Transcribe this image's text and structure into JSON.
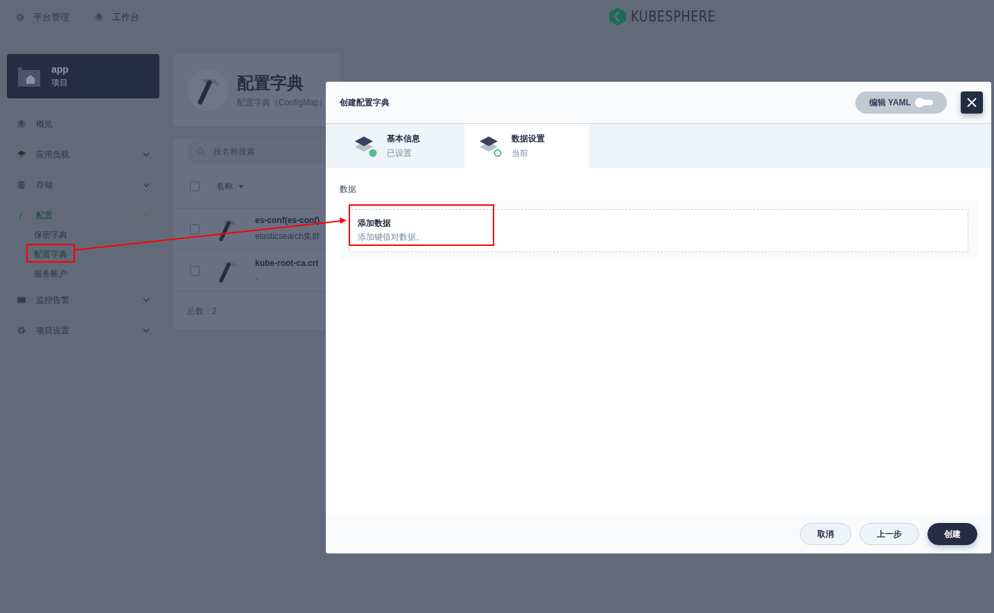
{
  "top_nav": [
    {
      "label": "平台管理"
    },
    {
      "label": "工作台"
    }
  ],
  "logo": {
    "text": "KUBESPHERE"
  },
  "project": {
    "name": "app",
    "type": "项目"
  },
  "sidebar": {
    "items": [
      {
        "label": "概览",
        "selected": false
      },
      {
        "label": "应用负载",
        "selected": false,
        "expanded": false
      },
      {
        "label": "存储",
        "selected": false,
        "expanded": false
      },
      {
        "label": "配置",
        "selected": true,
        "expanded": true,
        "children": [
          {
            "label": "保密字典",
            "selected": false
          },
          {
            "label": "配置字典",
            "selected": true
          },
          {
            "label": "服务帐户",
            "selected": false
          }
        ]
      },
      {
        "label": "监控告警",
        "selected": false,
        "expanded": false
      },
      {
        "label": "项目设置",
        "selected": false,
        "expanded": false
      }
    ]
  },
  "page_header": {
    "title": "配置字典",
    "subtitle": "配置字典（ConfigMap）"
  },
  "list": {
    "search": {
      "placeholder": "按名称搜索"
    },
    "header": {
      "checked": false,
      "column": "名称"
    },
    "rows": [
      {
        "name": "es-conf(es-conf)",
        "description": "elasticsearch集群",
        "checked": false
      },
      {
        "name": "kube-root-ca.crt",
        "description": "-",
        "checked": false
      }
    ],
    "total": "总数：2"
  },
  "modal": {
    "title": "创建配置字典",
    "yaml_toggle": {
      "label": "编辑 YAML",
      "on": false
    },
    "steps": [
      {
        "title": "基本信息",
        "status": "已设置",
        "selected": false,
        "done": true
      },
      {
        "title": "数据设置",
        "status": "当前",
        "selected": true,
        "done": false
      }
    ],
    "section_label": "数据",
    "add_data": {
      "title": "添加数据",
      "description": "添加键值对数据。"
    },
    "buttons": [
      {
        "label": "取消",
        "kind": "secondary"
      },
      {
        "label": "上一步",
        "kind": "secondary"
      },
      {
        "label": "创建",
        "kind": "primary"
      }
    ]
  }
}
